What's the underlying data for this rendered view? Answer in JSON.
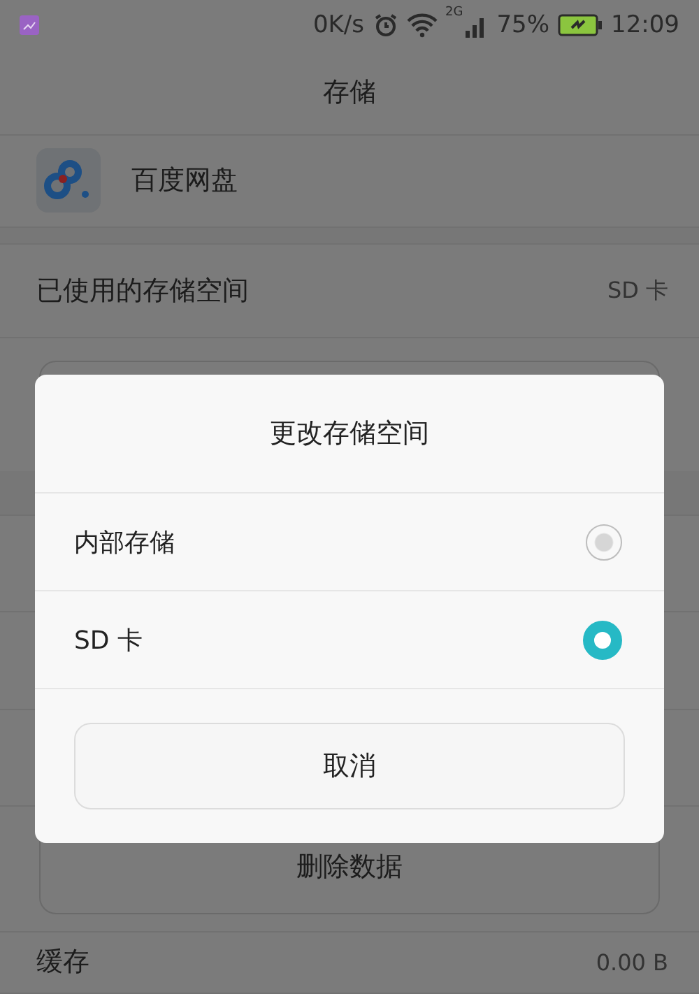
{
  "status_bar": {
    "speed": "0K/s",
    "network": "2G",
    "battery": "75%",
    "time": "12:09"
  },
  "title": "存储",
  "app": {
    "name": "百度网盘"
  },
  "storage_used": {
    "label": "已使用的存储空间",
    "value": "SD 卡"
  },
  "delete_button": "删除数据",
  "cache": {
    "label": "缓存",
    "value": "0.00 B"
  },
  "dialog": {
    "title": "更改存储空间",
    "options": [
      {
        "label": "内部存储",
        "selected": false
      },
      {
        "label": "SD 卡",
        "selected": true
      }
    ],
    "cancel": "取消"
  }
}
